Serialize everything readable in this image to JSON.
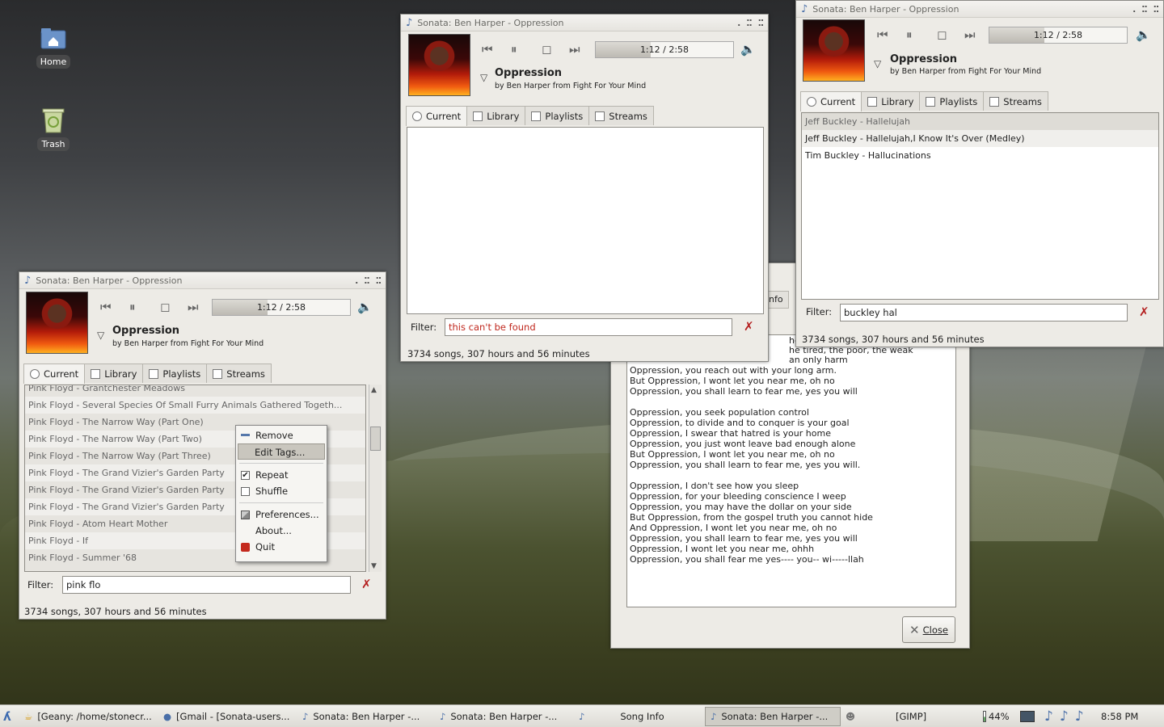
{
  "desktop": {
    "icons": [
      {
        "label": "Home",
        "icon": "home-folder-icon"
      },
      {
        "label": "Trash",
        "icon": "trash-icon"
      }
    ]
  },
  "player_common": {
    "app_title": "Sonata: Ben Harper - Oppression",
    "time": "1:12 / 2:58",
    "progress_fraction": 0.4,
    "song_title": "Oppression",
    "song_sub": "by Ben Harper from Fight For Your Mind",
    "tabs": [
      "Current",
      "Library",
      "Playlists",
      "Streams"
    ],
    "filter_label": "Filter:",
    "status": "3734 songs, 307 hours and 56 minutes"
  },
  "left_window": {
    "filter_value": "pink flo",
    "rows": [
      "Pink Floyd - Grantchester Meadows",
      "Pink Floyd - Several Species Of Small Furry Animals Gathered Togeth...",
      "Pink Floyd - The Narrow Way (Part One)",
      "Pink Floyd - The Narrow Way (Part Two)",
      "Pink Floyd - The Narrow Way (Part Three)",
      "Pink Floyd - The Grand Vizier's Garden Party",
      "Pink Floyd - The Grand Vizier's Garden Party",
      "Pink Floyd - The Grand Vizier's Garden Party",
      "Pink Floyd - Atom Heart Mother",
      "Pink Floyd - If",
      "Pink Floyd - Summer '68"
    ]
  },
  "context_menu": {
    "items": [
      "Remove",
      "Edit Tags...",
      "Repeat",
      "Shuffle",
      "Preferences...",
      "About...",
      "Quit"
    ]
  },
  "middle_window": {
    "filter_value": "this can't be found",
    "filter_color": "#c0281e"
  },
  "right_window": {
    "filter_value": "buckley hal",
    "rows": [
      "Jeff Buckley - Hallelujah",
      "Jeff Buckley - Hallelujah,I Know It's Over (Medley)",
      "Tim Buckley - Hallucinations"
    ]
  },
  "song_info": {
    "tab_fragment": "nfo",
    "lyrics_top_fragments": [
      "hen w",
      "he tired, the poor, the weak",
      "an only harm"
    ],
    "lyrics": "Oppression, you reach out with your long arm.\nBut Oppression, I wont let you near me, oh no\nOppression, you shall learn to fear me, yes you will\n\nOppression, you seek population control\nOppression, to divide and to conquer is your goal\nOppression, I swear that hatred is your home\nOppression, you just wont leave bad enough alone\nBut Oppression, I wont let you near me, oh no\nOppression, you shall learn to fear me, yes you will.\n\nOppression, I don't see how you sleep\nOppression, for your bleeding conscience I weep\nOppression, you may have the dollar on your side\nBut Oppression, from the gospel truth you cannot hide\nAnd Oppression, I wont let you near me, oh no\nOppression, you shall learn to fear me, yes you will\nOppression, I wont let you near me, ohhh\nOppression, you shall fear me yes---- you-- wi-----llah",
    "close_label": "Close"
  },
  "taskbar": {
    "items": [
      {
        "label": "[Geany: /home/stonecr...",
        "active": false
      },
      {
        "label": "[Gmail - [Sonata-users...",
        "active": false
      },
      {
        "label": "Sonata: Ben Harper -...",
        "active": false
      },
      {
        "label": "Sonata: Ben Harper -...",
        "active": false
      },
      {
        "label": "Song Info",
        "active": false
      },
      {
        "label": "Sonata: Ben Harper -...",
        "active": true
      },
      {
        "label": "[GIMP]",
        "active": false
      }
    ],
    "battery": "44%",
    "clock": "8:58 PM"
  }
}
